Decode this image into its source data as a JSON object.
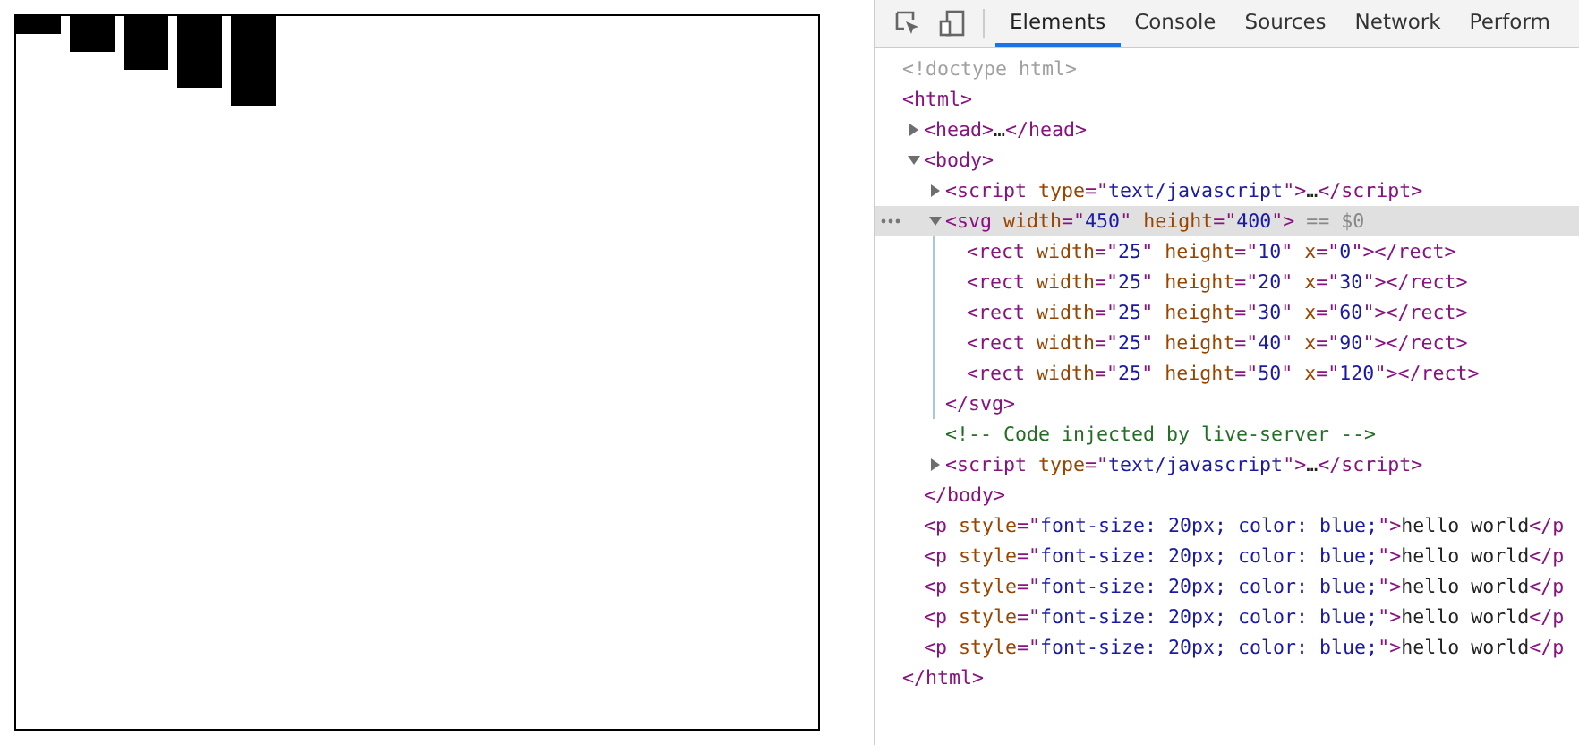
{
  "devtools": {
    "tabs": [
      {
        "label": "Elements",
        "selected": true
      },
      {
        "label": "Console",
        "selected": false
      },
      {
        "label": "Sources",
        "selected": false
      },
      {
        "label": "Network",
        "selected": false
      },
      {
        "label": "Perform",
        "selected": false
      }
    ],
    "dom_tree": [
      {
        "parts": [
          {
            "kind": "doctype",
            "t": "<!doctype html>"
          }
        ]
      },
      {
        "parts": [
          {
            "kind": "tag",
            "t": "<html>"
          }
        ],
        "close": [
          {
            "kind": "tag",
            "t": "</html>"
          }
        ],
        "children": [
          {
            "expanded": false,
            "parts": [
              {
                "kind": "tag",
                "t": "<head>"
              },
              {
                "kind": "text",
                "t": "…"
              },
              {
                "kind": "tag",
                "t": "</head>"
              }
            ]
          },
          {
            "expanded": true,
            "parts": [
              {
                "kind": "tag",
                "t": "<body>"
              }
            ],
            "close": [
              {
                "kind": "tag",
                "t": "</body>"
              }
            ],
            "children": [
              {
                "expanded": false,
                "parts": [
                  {
                    "kind": "tag",
                    "t": "<script "
                  },
                  {
                    "kind": "attr",
                    "t": "type"
                  },
                  {
                    "kind": "tag",
                    "t": "=\""
                  },
                  {
                    "kind": "val",
                    "t": "text/javascript"
                  },
                  {
                    "kind": "tag",
                    "t": "\">"
                  },
                  {
                    "kind": "text",
                    "t": "…"
                  },
                  {
                    "kind": "tag",
                    "t": "</script>"
                  }
                ]
              },
              {
                "expanded": true,
                "selected": true,
                "parts": [
                  {
                    "kind": "tag",
                    "t": "<svg "
                  },
                  {
                    "kind": "attr",
                    "t": "width"
                  },
                  {
                    "kind": "tag",
                    "t": "=\""
                  },
                  {
                    "kind": "val",
                    "t": "450"
                  },
                  {
                    "kind": "tag",
                    "t": "\" "
                  },
                  {
                    "kind": "attr",
                    "t": "height"
                  },
                  {
                    "kind": "tag",
                    "t": "=\""
                  },
                  {
                    "kind": "val",
                    "t": "400"
                  },
                  {
                    "kind": "tag",
                    "t": "\">"
                  },
                  {
                    "kind": "dim",
                    "t": " == $0"
                  }
                ],
                "close": [
                  {
                    "kind": "tag",
                    "t": "</svg>"
                  }
                ],
                "children": [
                  {
                    "parts": [
                      {
                        "kind": "tag",
                        "t": "<rect "
                      },
                      {
                        "kind": "attr",
                        "t": "width"
                      },
                      {
                        "kind": "tag",
                        "t": "=\""
                      },
                      {
                        "kind": "val",
                        "t": "25"
                      },
                      {
                        "kind": "tag",
                        "t": "\" "
                      },
                      {
                        "kind": "attr",
                        "t": "height"
                      },
                      {
                        "kind": "tag",
                        "t": "=\""
                      },
                      {
                        "kind": "val",
                        "t": "10"
                      },
                      {
                        "kind": "tag",
                        "t": "\" "
                      },
                      {
                        "kind": "attr",
                        "t": "x"
                      },
                      {
                        "kind": "tag",
                        "t": "=\""
                      },
                      {
                        "kind": "val",
                        "t": "0"
                      },
                      {
                        "kind": "tag",
                        "t": "\"></rect>"
                      }
                    ]
                  },
                  {
                    "parts": [
                      {
                        "kind": "tag",
                        "t": "<rect "
                      },
                      {
                        "kind": "attr",
                        "t": "width"
                      },
                      {
                        "kind": "tag",
                        "t": "=\""
                      },
                      {
                        "kind": "val",
                        "t": "25"
                      },
                      {
                        "kind": "tag",
                        "t": "\" "
                      },
                      {
                        "kind": "attr",
                        "t": "height"
                      },
                      {
                        "kind": "tag",
                        "t": "=\""
                      },
                      {
                        "kind": "val",
                        "t": "20"
                      },
                      {
                        "kind": "tag",
                        "t": "\" "
                      },
                      {
                        "kind": "attr",
                        "t": "x"
                      },
                      {
                        "kind": "tag",
                        "t": "=\""
                      },
                      {
                        "kind": "val",
                        "t": "30"
                      },
                      {
                        "kind": "tag",
                        "t": "\"></rect>"
                      }
                    ]
                  },
                  {
                    "parts": [
                      {
                        "kind": "tag",
                        "t": "<rect "
                      },
                      {
                        "kind": "attr",
                        "t": "width"
                      },
                      {
                        "kind": "tag",
                        "t": "=\""
                      },
                      {
                        "kind": "val",
                        "t": "25"
                      },
                      {
                        "kind": "tag",
                        "t": "\" "
                      },
                      {
                        "kind": "attr",
                        "t": "height"
                      },
                      {
                        "kind": "tag",
                        "t": "=\""
                      },
                      {
                        "kind": "val",
                        "t": "30"
                      },
                      {
                        "kind": "tag",
                        "t": "\" "
                      },
                      {
                        "kind": "attr",
                        "t": "x"
                      },
                      {
                        "kind": "tag",
                        "t": "=\""
                      },
                      {
                        "kind": "val",
                        "t": "60"
                      },
                      {
                        "kind": "tag",
                        "t": "\"></rect>"
                      }
                    ]
                  },
                  {
                    "parts": [
                      {
                        "kind": "tag",
                        "t": "<rect "
                      },
                      {
                        "kind": "attr",
                        "t": "width"
                      },
                      {
                        "kind": "tag",
                        "t": "=\""
                      },
                      {
                        "kind": "val",
                        "t": "25"
                      },
                      {
                        "kind": "tag",
                        "t": "\" "
                      },
                      {
                        "kind": "attr",
                        "t": "height"
                      },
                      {
                        "kind": "tag",
                        "t": "=\""
                      },
                      {
                        "kind": "val",
                        "t": "40"
                      },
                      {
                        "kind": "tag",
                        "t": "\" "
                      },
                      {
                        "kind": "attr",
                        "t": "x"
                      },
                      {
                        "kind": "tag",
                        "t": "=\""
                      },
                      {
                        "kind": "val",
                        "t": "90"
                      },
                      {
                        "kind": "tag",
                        "t": "\"></rect>"
                      }
                    ]
                  },
                  {
                    "parts": [
                      {
                        "kind": "tag",
                        "t": "<rect "
                      },
                      {
                        "kind": "attr",
                        "t": "width"
                      },
                      {
                        "kind": "tag",
                        "t": "=\""
                      },
                      {
                        "kind": "val",
                        "t": "25"
                      },
                      {
                        "kind": "tag",
                        "t": "\" "
                      },
                      {
                        "kind": "attr",
                        "t": "height"
                      },
                      {
                        "kind": "tag",
                        "t": "=\""
                      },
                      {
                        "kind": "val",
                        "t": "50"
                      },
                      {
                        "kind": "tag",
                        "t": "\" "
                      },
                      {
                        "kind": "attr",
                        "t": "x"
                      },
                      {
                        "kind": "tag",
                        "t": "=\""
                      },
                      {
                        "kind": "val",
                        "t": "120"
                      },
                      {
                        "kind": "tag",
                        "t": "\"></rect>"
                      }
                    ]
                  }
                ]
              },
              {
                "parts": [
                  {
                    "kind": "comment",
                    "t": "<!-- Code injected by live-server -->"
                  }
                ]
              },
              {
                "expanded": false,
                "parts": [
                  {
                    "kind": "tag",
                    "t": "<script "
                  },
                  {
                    "kind": "attr",
                    "t": "type"
                  },
                  {
                    "kind": "tag",
                    "t": "=\""
                  },
                  {
                    "kind": "val",
                    "t": "text/javascript"
                  },
                  {
                    "kind": "tag",
                    "t": "\">"
                  },
                  {
                    "kind": "text",
                    "t": "…"
                  },
                  {
                    "kind": "tag",
                    "t": "</script>"
                  }
                ]
              }
            ]
          },
          {
            "parts": [
              {
                "kind": "tag",
                "t": "<p "
              },
              {
                "kind": "attr",
                "t": "style"
              },
              {
                "kind": "tag",
                "t": "=\""
              },
              {
                "kind": "val",
                "t": "font-size: 20px; color: blue;"
              },
              {
                "kind": "tag",
                "t": "\">"
              },
              {
                "kind": "text",
                "t": "hello world"
              },
              {
                "kind": "tag",
                "t": "</p"
              }
            ]
          },
          {
            "parts": [
              {
                "kind": "tag",
                "t": "<p "
              },
              {
                "kind": "attr",
                "t": "style"
              },
              {
                "kind": "tag",
                "t": "=\""
              },
              {
                "kind": "val",
                "t": "font-size: 20px; color: blue;"
              },
              {
                "kind": "tag",
                "t": "\">"
              },
              {
                "kind": "text",
                "t": "hello world"
              },
              {
                "kind": "tag",
                "t": "</p"
              }
            ]
          },
          {
            "parts": [
              {
                "kind": "tag",
                "t": "<p "
              },
              {
                "kind": "attr",
                "t": "style"
              },
              {
                "kind": "tag",
                "t": "=\""
              },
              {
                "kind": "val",
                "t": "font-size: 20px; color: blue;"
              },
              {
                "kind": "tag",
                "t": "\">"
              },
              {
                "kind": "text",
                "t": "hello world"
              },
              {
                "kind": "tag",
                "t": "</p"
              }
            ]
          },
          {
            "parts": [
              {
                "kind": "tag",
                "t": "<p "
              },
              {
                "kind": "attr",
                "t": "style"
              },
              {
                "kind": "tag",
                "t": "=\""
              },
              {
                "kind": "val",
                "t": "font-size: 20px; color: blue;"
              },
              {
                "kind": "tag",
                "t": "\">"
              },
              {
                "kind": "text",
                "t": "hello world"
              },
              {
                "kind": "tag",
                "t": "</p"
              }
            ]
          },
          {
            "parts": [
              {
                "kind": "tag",
                "t": "<p "
              },
              {
                "kind": "attr",
                "t": "style"
              },
              {
                "kind": "tag",
                "t": "=\""
              },
              {
                "kind": "val",
                "t": "font-size: 20px; color: blue;"
              },
              {
                "kind": "tag",
                "t": "\">"
              },
              {
                "kind": "text",
                "t": "hello world"
              },
              {
                "kind": "tag",
                "t": "</p"
              }
            ]
          }
        ]
      }
    ]
  }
}
